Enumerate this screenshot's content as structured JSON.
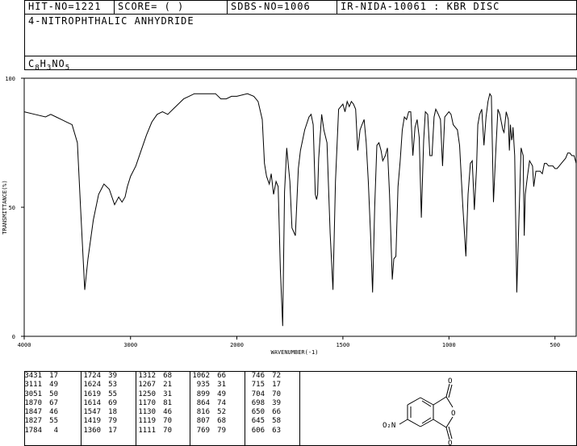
{
  "header": {
    "hit_no": "HIT-NO=1221",
    "score": "SCORE=  (   )",
    "sdbs_no": "SDBS-NO=1006",
    "ir_nida": "IR-NIDA-10061 : KBR DISC",
    "compound_name": "4-NITROPHTHALIC ANHYDRIDE",
    "formula": {
      "c": "C",
      "c_n": "8",
      "h": "H",
      "h_n": "3",
      "n": "N",
      "o": "O",
      "o_n": "5"
    }
  },
  "chart_data": {
    "type": "line",
    "xlabel": "WAVENUMBER(-1)",
    "ylabel": "TRANSMITTANCE(%)",
    "xlim": [
      4000,
      400
    ],
    "ylim": [
      0,
      100
    ],
    "x_ticks": [
      "4000",
      "3000",
      "2000",
      "1500",
      "1000",
      "500"
    ],
    "y_ticks": [
      "100",
      "50",
      "0"
    ],
    "x": [
      4000,
      3900,
      3800,
      3750,
      3700,
      3650,
      3600,
      3550,
      3500,
      3470,
      3431,
      3400,
      3350,
      3300,
      3250,
      3200,
      3150,
      3111,
      3080,
      3051,
      3030,
      3000,
      2950,
      2900,
      2850,
      2800,
      2750,
      2700,
      2650,
      2600,
      2550,
      2500,
      2450,
      2400,
      2350,
      2300,
      2250,
      2200,
      2150,
      2100,
      2050,
      2000,
      1950,
      1920,
      1900,
      1880,
      1870,
      1860,
      1847,
      1838,
      1827,
      1815,
      1805,
      1795,
      1784,
      1775,
      1765,
      1750,
      1740,
      1724,
      1710,
      1700,
      1680,
      1660,
      1650,
      1640,
      1630,
      1624,
      1619,
      1614,
      1600,
      1590,
      1575,
      1560,
      1547,
      1535,
      1520,
      1500,
      1490,
      1480,
      1470,
      1460,
      1450,
      1440,
      1430,
      1419,
      1410,
      1400,
      1390,
      1380,
      1370,
      1360,
      1350,
      1340,
      1330,
      1320,
      1312,
      1300,
      1290,
      1280,
      1267,
      1260,
      1250,
      1240,
      1230,
      1220,
      1210,
      1200,
      1190,
      1180,
      1170,
      1160,
      1150,
      1140,
      1130,
      1119,
      1111,
      1100,
      1090,
      1080,
      1070,
      1062,
      1050,
      1040,
      1030,
      1020,
      1010,
      1000,
      990,
      980,
      970,
      960,
      950,
      935,
      920,
      910,
      899,
      890,
      880,
      870,
      864,
      855,
      845,
      835,
      825,
      816,
      807,
      800,
      790,
      780,
      769,
      760,
      746,
      740,
      730,
      720,
      715,
      710,
      704,
      700,
      698,
      690,
      680,
      670,
      660,
      650,
      645,
      640,
      630,
      620,
      606,
      600,
      590,
      580,
      570,
      560,
      550,
      540,
      530,
      520,
      510,
      500,
      490,
      480,
      470,
      460,
      450,
      440,
      430,
      420,
      410,
      400
    ],
    "series": [
      {
        "values": [
          87,
          86,
          85,
          86,
          85,
          84,
          83,
          82,
          75,
          50,
          18,
          30,
          45,
          55,
          59,
          57,
          51,
          54,
          52,
          54,
          58,
          62,
          66,
          72,
          78,
          83,
          86,
          87,
          86,
          88,
          90,
          92,
          93,
          94,
          94,
          94,
          94,
          94,
          92,
          92,
          93,
          93,
          94,
          93,
          91,
          84,
          67,
          62,
          59,
          63,
          55,
          60,
          58,
          26,
          4,
          56,
          73,
          60,
          42,
          39,
          65,
          72,
          80,
          85,
          86,
          82,
          55,
          53,
          55,
          69,
          86,
          80,
          75,
          40,
          18,
          60,
          88,
          90,
          87,
          91,
          89,
          91,
          90,
          88,
          72,
          80,
          82,
          84,
          75,
          60,
          40,
          17,
          50,
          74,
          75,
          72,
          68,
          70,
          73,
          55,
          22,
          30,
          31,
          58,
          68,
          80,
          85,
          84,
          87,
          87,
          70,
          81,
          84,
          77,
          46,
          76,
          87,
          86,
          70,
          70,
          85,
          88,
          86,
          84,
          66,
          85,
          86,
          87,
          86,
          82,
          81,
          80,
          74,
          51,
          31,
          55,
          67,
          68,
          49,
          65,
          82,
          86,
          88,
          74,
          85,
          91,
          94,
          93,
          52,
          70,
          88,
          86,
          80,
          79,
          87,
          84,
          72,
          82,
          76,
          78,
          81,
          70,
          17,
          45,
          73,
          70,
          39,
          55,
          62,
          68,
          66,
          58,
          64,
          64,
          64,
          63,
          67,
          67,
          66,
          66,
          66,
          65,
          65,
          66,
          67,
          68,
          69,
          71,
          71,
          70,
          70,
          67,
          65,
          62,
          63,
          64
        ]
      }
    ]
  },
  "peaks": [
    [
      [
        3431,
        17
      ],
      [
        3111,
        49
      ],
      [
        3051,
        50
      ],
      [
        1870,
        67
      ],
      [
        1847,
        46
      ],
      [
        1827,
        55
      ],
      [
        1784,
        4
      ]
    ],
    [
      [
        1724,
        39
      ],
      [
        1624,
        53
      ],
      [
        1619,
        55
      ],
      [
        1614,
        69
      ],
      [
        1547,
        18
      ],
      [
        1419,
        79
      ],
      [
        1360,
        17
      ]
    ],
    [
      [
        1312,
        68
      ],
      [
        1267,
        21
      ],
      [
        1250,
        31
      ],
      [
        1170,
        81
      ],
      [
        1130,
        46
      ],
      [
        1119,
        70
      ],
      [
        1111,
        70
      ]
    ],
    [
      [
        1062,
        66
      ],
      [
        935,
        31
      ],
      [
        899,
        49
      ],
      [
        864,
        74
      ],
      [
        816,
        52
      ],
      [
        807,
        68
      ],
      [
        769,
        79
      ]
    ],
    [
      [
        746,
        72
      ],
      [
        715,
        17
      ],
      [
        704,
        70
      ],
      [
        698,
        39
      ],
      [
        650,
        66
      ],
      [
        645,
        58
      ],
      [
        606,
        63
      ]
    ]
  ],
  "structure": {
    "o_top": "O",
    "o_ring": "O",
    "o_bottom": "O",
    "nitro": "O₂N"
  }
}
